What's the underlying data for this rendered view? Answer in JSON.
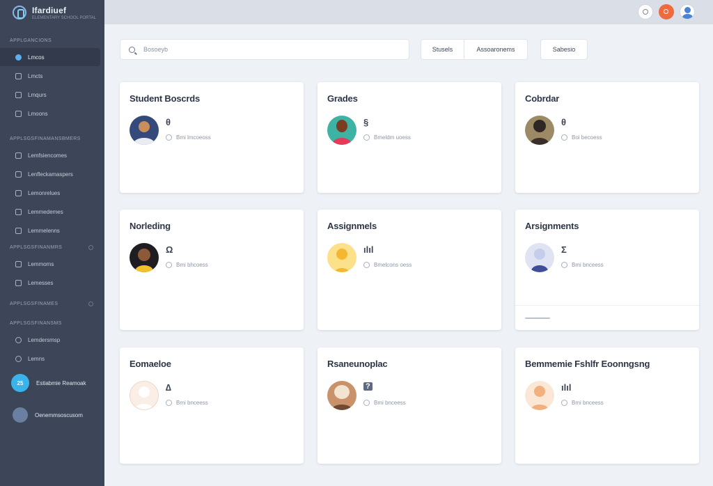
{
  "app": {
    "name": "Ifardiuef",
    "subtitle": "ELEMENTARY SCHOOL PORTAL"
  },
  "sidebar": {
    "sections": [
      {
        "label": "Applgancions",
        "items": [
          {
            "label": "Lmcos",
            "active": true
          },
          {
            "label": "Lmcts",
            "active": false
          },
          {
            "label": "Lmqurs",
            "active": false
          },
          {
            "label": "Lmoons",
            "active": false
          }
        ]
      },
      {
        "label": "Applsgsfinamansbmers",
        "items": [
          {
            "label": "Lemfsiencomes",
            "active": false
          },
          {
            "label": "Lenfleckamaspers",
            "active": false
          },
          {
            "label": "Lemonrelues",
            "active": false
          },
          {
            "label": "Lemmedemes",
            "active": false
          },
          {
            "label": "Lemmelenns",
            "active": false
          }
        ]
      },
      {
        "label": "Applsgsfinanmrs",
        "items": [
          {
            "label": "Lemmoms",
            "active": false
          },
          {
            "label": "Lemesses",
            "active": false
          }
        ]
      },
      {
        "label": "Applsgsfinames",
        "items": []
      },
      {
        "label": "Applsgsfinansms",
        "items": [
          {
            "label": "Lemdersmsp",
            "active": false
          },
          {
            "label": "Lemns",
            "active": false
          }
        ]
      }
    ],
    "user_primary": {
      "initials": "25",
      "name": "Estiabmie Reamoak"
    },
    "user_secondary": {
      "name": "Oenemmsoscusom"
    }
  },
  "search": {
    "placeholder": "Bosoeyb"
  },
  "toolbar": {
    "btn1": "Stusels",
    "btn2": "Assoaronems",
    "btn3": "Sabesio"
  },
  "cards": [
    {
      "title": "Student Boscrds",
      "glyph": "θ",
      "meta": "Bmi lmcoeoss"
    },
    {
      "title": "Grades",
      "glyph": "§",
      "meta": "Bmeldm uoess"
    },
    {
      "title": "Cobrdar",
      "glyph": "θ",
      "meta": "Boi becoess"
    },
    {
      "title": "Norleding",
      "glyph": "Ω",
      "meta": "Bmi bhcoess"
    },
    {
      "title": "Assignmels",
      "glyph": "ılıl",
      "meta": "Bmelcons oess"
    },
    {
      "title": "Arsignments",
      "glyph": "Σ",
      "meta": "Bmi bnceess"
    },
    {
      "title": "Eomaeloe",
      "glyph": "∆",
      "meta": "Bmi bnceess"
    },
    {
      "title": "Rsaneunoplac",
      "glyph": "?",
      "meta": "Bmi bnceess"
    },
    {
      "title": "Bemmemie Fshlfr Eoonngsng",
      "glyph": "ılıl",
      "meta": "Bmi bnceess"
    }
  ],
  "colors": {
    "sidebar": "#3d4659",
    "accent": "#39b3ea",
    "orange": "#ef6a3d"
  }
}
